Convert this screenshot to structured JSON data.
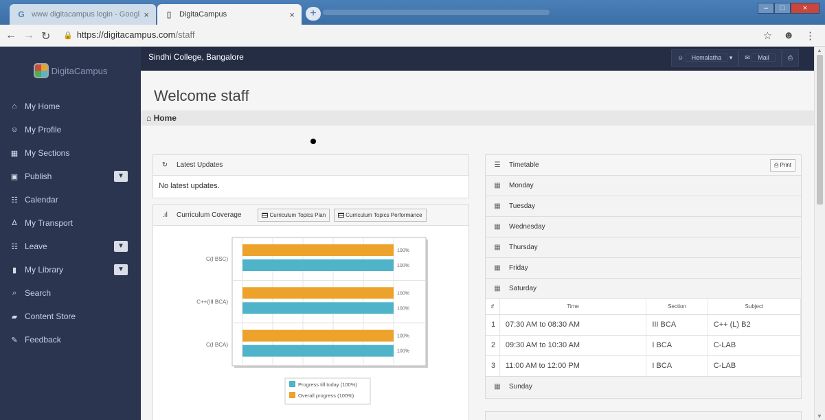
{
  "browser": {
    "tabs": [
      {
        "label": "www digitacampus login - Googl",
        "favicon": "google-icon",
        "active": false
      },
      {
        "label": "DigitaCampus",
        "favicon": "page-icon",
        "active": true
      }
    ],
    "url_host": "https://digitacampus.com",
    "url_path": "/staff"
  },
  "app": {
    "logo_text": "DigitaCampus",
    "college": "Sindhi College, Bangalore",
    "user": "Hemalatha",
    "mail": "Mail"
  },
  "sidebar": {
    "items": [
      {
        "label": "My Home",
        "icon": "home-icon",
        "glyph": "⌂",
        "dropdown": false
      },
      {
        "label": "My Profile",
        "icon": "user-icon",
        "glyph": "☺",
        "dropdown": false
      },
      {
        "label": "My Sections",
        "icon": "grid-icon",
        "glyph": "▦",
        "dropdown": false
      },
      {
        "label": "Publish",
        "icon": "image-icon",
        "glyph": "▣",
        "dropdown": true
      },
      {
        "label": "Calendar",
        "icon": "calendar-icon",
        "glyph": "☷",
        "dropdown": false
      },
      {
        "label": "My Transport",
        "icon": "road-icon",
        "glyph": "∆",
        "dropdown": false
      },
      {
        "label": "Leave",
        "icon": "calendar-icon",
        "glyph": "☷",
        "dropdown": true
      },
      {
        "label": "My Library",
        "icon": "book-icon",
        "glyph": "▮",
        "dropdown": true
      },
      {
        "label": "Search",
        "icon": "search-icon",
        "glyph": "⌕",
        "dropdown": false
      },
      {
        "label": "Content Store",
        "icon": "folder-icon",
        "glyph": "▰",
        "dropdown": false
      },
      {
        "label": "Feedback",
        "icon": "edit-icon",
        "glyph": "✎",
        "dropdown": false
      }
    ]
  },
  "main": {
    "welcome": "Welcome staff",
    "breadcrumb": "Home"
  },
  "updates": {
    "title": "Latest Updates",
    "empty_text": "No latest updates."
  },
  "coverage": {
    "title": "Curriculum Coverage",
    "btn_plan": "Curriculum Topics Plan",
    "btn_performance": "Curriculum Topics Performance"
  },
  "chart_data": {
    "type": "bar",
    "orientation": "horizontal",
    "categories": [
      "C(I BSC)",
      "C++(III BCA)",
      "C(I BCA)"
    ],
    "series": [
      {
        "name": "Overall progress (100%)",
        "values": [
          100,
          100,
          100
        ],
        "color": "#eda22c"
      },
      {
        "name": "Progress till today (100%)",
        "values": [
          100,
          100,
          100
        ],
        "color": "#4fb4c9"
      }
    ],
    "value_labels": [
      "100%",
      "100%",
      "100%",
      "100%",
      "100%",
      "100%"
    ],
    "xlim": [
      0,
      100
    ],
    "grid": true,
    "legend_position": "bottom"
  },
  "timetable": {
    "title": "Timetable",
    "print": "Print",
    "days_before": [
      "Monday",
      "Tuesday",
      "Wednesday",
      "Thursday",
      "Friday",
      "Saturday"
    ],
    "columns": [
      "#",
      "Time",
      "Section",
      "Subject"
    ],
    "rows": [
      [
        "1",
        "07:30 AM to 08:30 AM",
        "III BCA",
        "C++ (L) B2"
      ],
      [
        "2",
        "09:30 AM to 10:30 AM",
        "I BCA",
        "C-LAB"
      ],
      [
        "3",
        "11:00 AM to 12:00 PM",
        "I BCA",
        "C-LAB"
      ]
    ],
    "days_after": [
      "Sunday"
    ]
  },
  "colors": {
    "sidebar": "#2c3550",
    "topbar": "#252d44",
    "orange": "#eda22c",
    "teal": "#4fb4c9"
  }
}
